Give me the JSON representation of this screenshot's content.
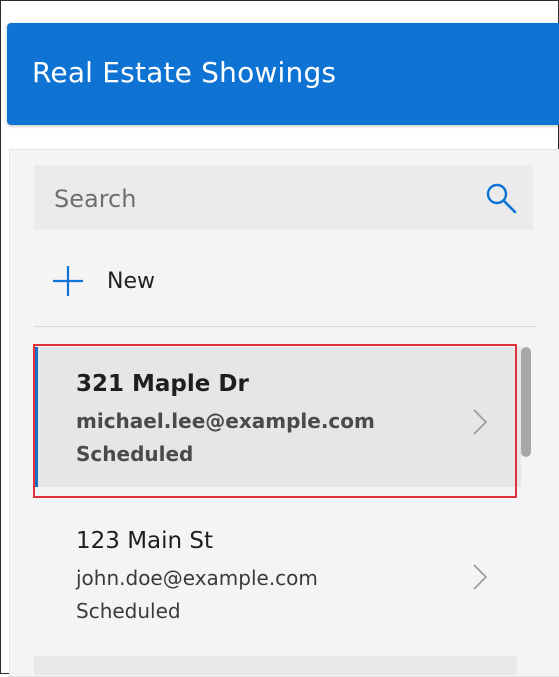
{
  "app": {
    "title": "Real Estate Showings"
  },
  "search": {
    "placeholder": "Search",
    "icon": "search-icon"
  },
  "toolbar": {
    "new_label": "New",
    "new_icon": "plus-icon"
  },
  "list": {
    "items": [
      {
        "address": "321 Maple Dr",
        "email": "michael.lee@example.com",
        "status": "Scheduled"
      },
      {
        "address": "123 Main St",
        "email": "john.doe@example.com",
        "status": "Scheduled"
      }
    ]
  },
  "colors": {
    "header": "#0f73d3",
    "accent": "#1b6fc3",
    "selection_outline": "#e0313a",
    "selected_row": "#e6e6e6"
  }
}
